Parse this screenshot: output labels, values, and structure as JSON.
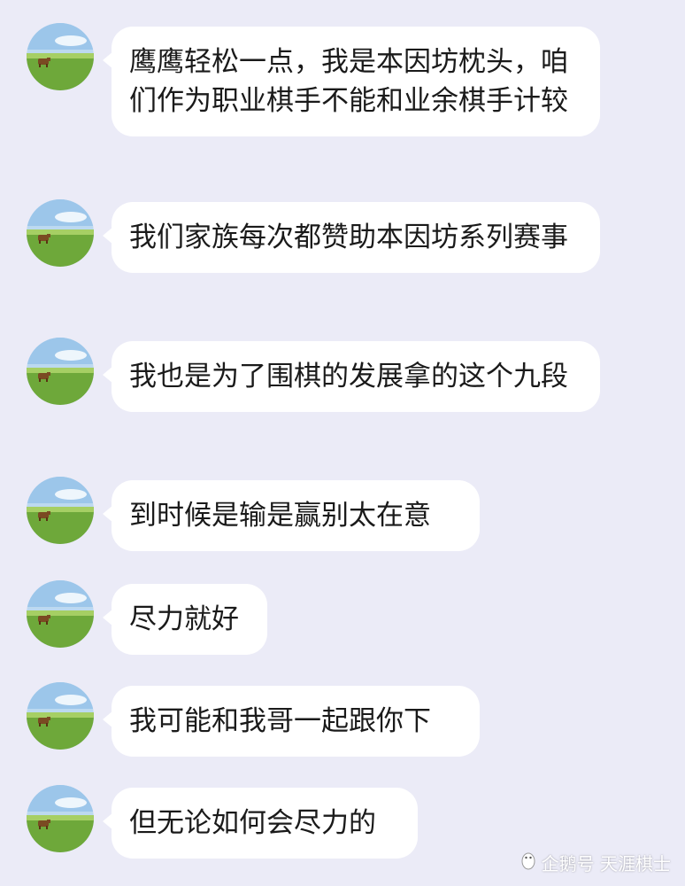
{
  "messages": [
    {
      "text": "鹰鹰轻松一点，我是本因坊枕头，咱们作为职业棋手不能和业余棋手计较"
    },
    {
      "text": "我们家族每次都赞助本因坊系列赛事"
    },
    {
      "text": "我也是为了围棋的发展拿的这个九段"
    },
    {
      "text": "到时候是输是赢别太在意"
    },
    {
      "text": "尽力就好"
    },
    {
      "text": "我可能和我哥一起跟你下"
    },
    {
      "text": "但无论如何会尽力的"
    }
  ],
  "avatar_icon": "cow-on-grassland-avatar",
  "watermark": {
    "icon": "penguin-logo",
    "text": "企鹅号 天涯棋士"
  },
  "colors": {
    "background": "#ebebf7",
    "bubble": "#ffffff",
    "text": "#1a1a1a"
  }
}
